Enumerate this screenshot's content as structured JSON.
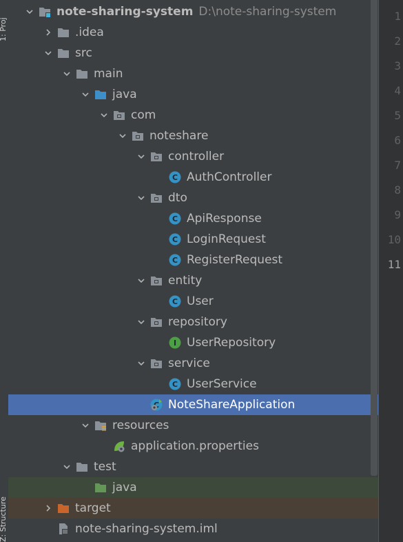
{
  "project_tree": {
    "root": {
      "name": "note-sharing-system",
      "path": "D:\\note-sharing-system"
    },
    "items": [
      {
        "label": "note-sharing-system",
        "path": "D:\\note-sharing-system",
        "depth": 0,
        "arrow": "down",
        "icon": "module-folder-icon",
        "bold": true
      },
      {
        "label": ".idea",
        "depth": 1,
        "arrow": "right",
        "icon": "folder-icon"
      },
      {
        "label": "src",
        "depth": 1,
        "arrow": "down",
        "icon": "folder-icon"
      },
      {
        "label": "main",
        "depth": 2,
        "arrow": "down",
        "icon": "folder-icon"
      },
      {
        "label": "java",
        "depth": 3,
        "arrow": "down",
        "icon": "source-root-folder-icon"
      },
      {
        "label": "com",
        "depth": 4,
        "arrow": "down",
        "icon": "package-icon"
      },
      {
        "label": "noteshare",
        "depth": 5,
        "arrow": "down",
        "icon": "package-icon"
      },
      {
        "label": "controller",
        "depth": 6,
        "arrow": "down",
        "icon": "package-icon"
      },
      {
        "label": "AuthController",
        "depth": 7,
        "arrow": "none",
        "icon": "class-icon"
      },
      {
        "label": "dto",
        "depth": 6,
        "arrow": "down",
        "icon": "package-icon"
      },
      {
        "label": "ApiResponse",
        "depth": 7,
        "arrow": "none",
        "icon": "class-icon"
      },
      {
        "label": "LoginRequest",
        "depth": 7,
        "arrow": "none",
        "icon": "class-icon"
      },
      {
        "label": "RegisterRequest",
        "depth": 7,
        "arrow": "none",
        "icon": "class-icon"
      },
      {
        "label": "entity",
        "depth": 6,
        "arrow": "down",
        "icon": "package-icon"
      },
      {
        "label": "User",
        "depth": 7,
        "arrow": "none",
        "icon": "class-icon"
      },
      {
        "label": "repository",
        "depth": 6,
        "arrow": "down",
        "icon": "package-icon"
      },
      {
        "label": "UserRepository",
        "depth": 7,
        "arrow": "none",
        "icon": "interface-icon"
      },
      {
        "label": "service",
        "depth": 6,
        "arrow": "down",
        "icon": "package-icon"
      },
      {
        "label": "UserService",
        "depth": 7,
        "arrow": "none",
        "icon": "class-icon"
      },
      {
        "label": "NoteShareApplication",
        "depth": 6,
        "arrow": "none",
        "icon": "spring-boot-app-icon",
        "selected": true
      },
      {
        "label": "resources",
        "depth": 3,
        "arrow": "down",
        "icon": "resources-folder-icon"
      },
      {
        "label": "application.properties",
        "depth": 4,
        "arrow": "none",
        "icon": "spring-properties-icon"
      },
      {
        "label": "test",
        "depth": 2,
        "arrow": "down",
        "icon": "folder-icon"
      },
      {
        "label": "java",
        "depth": 3,
        "arrow": "none",
        "icon": "test-root-folder-icon",
        "highlight": "test"
      },
      {
        "label": "target",
        "depth": 1,
        "arrow": "right",
        "icon": "excluded-folder-icon",
        "highlight": "target"
      },
      {
        "label": "note-sharing-system.iml",
        "depth": 1,
        "arrow": "none",
        "icon": "iml-file-icon"
      }
    ]
  },
  "side_tabs": {
    "top": "1: Proj",
    "bottom": "Z: Structure"
  },
  "gutter": {
    "line_numbers": [
      "1",
      "2",
      "3",
      "4",
      "5",
      "6",
      "7",
      "8",
      "9",
      "10",
      "11"
    ],
    "current_line": "11"
  },
  "colors": {
    "panel_bg": "#3c3f41",
    "selection": "#4b6eaf",
    "folder": "#8a9199",
    "source_root": "#3d8ec9",
    "test_root": "#629755",
    "excluded": "#c9652a",
    "class_icon": "#3592c4",
    "interface_icon": "#4c9f43"
  }
}
